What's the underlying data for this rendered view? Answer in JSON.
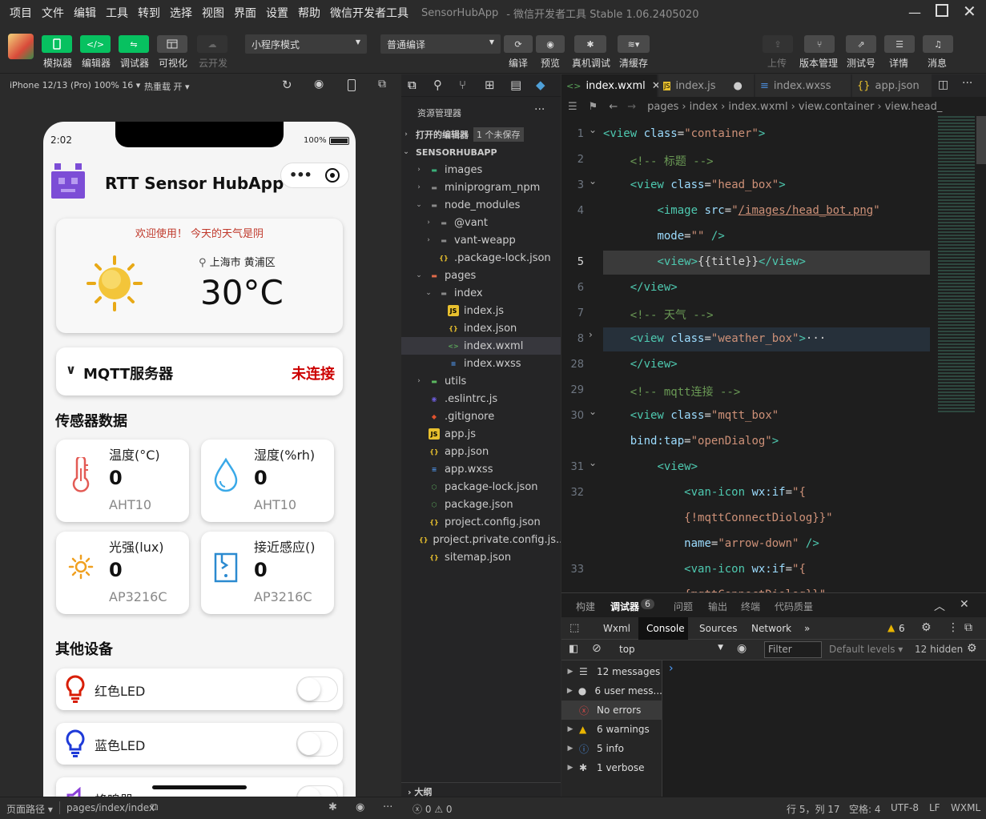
{
  "menubar": {
    "items": [
      "项目",
      "文件",
      "编辑",
      "工具",
      "转到",
      "选择",
      "视图",
      "界面",
      "设置",
      "帮助",
      "微信开发者工具"
    ],
    "app_title": "SensorHubApp",
    "window_title": "- 微信开发者工具 Stable 1.06.2405020"
  },
  "toolbar": {
    "simulator": "模拟器",
    "editor": "编辑器",
    "debugger": "调试器",
    "visual": "可视化",
    "cloud": "云开发",
    "mode_select": "小程序模式",
    "compile_select": "普通编译",
    "compile": "编译",
    "preview": "预览",
    "real_debug": "真机调试",
    "clear_cache": "清缓存",
    "upload": "上传",
    "version": "版本管理",
    "test": "测试号",
    "details": "详情",
    "messages": "消息"
  },
  "simulator_bar": {
    "device": "iPhone 12/13 (Pro) 100% 16",
    "hot_reload": "热重载 开"
  },
  "phone": {
    "time": "2:02",
    "battery": "100%",
    "app_title": "RTT Sensor HubApp",
    "weather": {
      "greeting": "欢迎使用！ 今天的天气是阴",
      "location": "上海市 黄浦区",
      "temperature": "30°C"
    },
    "mqtt": {
      "label": "MQTT服务器",
      "status": "未连接"
    },
    "sensors_title": "传感器数据",
    "sensors": [
      {
        "name": "温度(°C)",
        "value": "0",
        "chip": "AHT10",
        "icon": "thermometer-icon"
      },
      {
        "name": "湿度(%rh)",
        "value": "0",
        "chip": "AHT10",
        "icon": "water-drop-icon"
      },
      {
        "name": "光强(lux)",
        "value": "0",
        "chip": "AP3216C",
        "icon": "sun-icon"
      },
      {
        "name": "接近感应()",
        "value": "0",
        "chip": "AP3216C",
        "icon": "proximity-icon"
      }
    ],
    "devices_title": "其他设备",
    "devices": [
      {
        "label": "红色LED",
        "color": "#d81e06"
      },
      {
        "label": "蓝色LED",
        "color": "#1e3ad8"
      },
      {
        "label": "蜂鸣器",
        "color": "#8a3fd8"
      }
    ]
  },
  "explorer": {
    "title": "资源管理器",
    "open_editors": "打开的编辑器",
    "unsaved": "1 个未保存",
    "project": "SENSORHUBAPP",
    "outline": "大纲",
    "tree": [
      {
        "name": "images",
        "depth": 1,
        "kind": "folder-img",
        "open": false
      },
      {
        "name": "miniprogram_npm",
        "depth": 1,
        "kind": "folder",
        "open": false
      },
      {
        "name": "node_modules",
        "depth": 1,
        "kind": "folder",
        "open": true
      },
      {
        "name": "@vant",
        "depth": 2,
        "kind": "folder",
        "open": false
      },
      {
        "name": "vant-weapp",
        "depth": 2,
        "kind": "folder",
        "open": false
      },
      {
        "name": ".package-lock.json",
        "depth": 2,
        "kind": "json"
      },
      {
        "name": "pages",
        "depth": 1,
        "kind": "folder-pages",
        "open": true
      },
      {
        "name": "index",
        "depth": 2,
        "kind": "folder",
        "open": true
      },
      {
        "name": "index.js",
        "depth": 3,
        "kind": "js"
      },
      {
        "name": "index.json",
        "depth": 3,
        "kind": "json"
      },
      {
        "name": "index.wxml",
        "depth": 3,
        "kind": "wxml",
        "selected": true
      },
      {
        "name": "index.wxss",
        "depth": 3,
        "kind": "wxss"
      },
      {
        "name": "utils",
        "depth": 1,
        "kind": "folder-utils",
        "open": false
      },
      {
        "name": ".eslintrc.js",
        "depth": 1,
        "kind": "eslint"
      },
      {
        "name": ".gitignore",
        "depth": 1,
        "kind": "git"
      },
      {
        "name": "app.js",
        "depth": 1,
        "kind": "js"
      },
      {
        "name": "app.json",
        "depth": 1,
        "kind": "json"
      },
      {
        "name": "app.wxss",
        "depth": 1,
        "kind": "wxss"
      },
      {
        "name": "package-lock.json",
        "depth": 1,
        "kind": "npm"
      },
      {
        "name": "package.json",
        "depth": 1,
        "kind": "npm"
      },
      {
        "name": "project.config.json",
        "depth": 1,
        "kind": "json"
      },
      {
        "name": "project.private.config.js...",
        "depth": 1,
        "kind": "json"
      },
      {
        "name": "sitemap.json",
        "depth": 1,
        "kind": "json"
      }
    ]
  },
  "editor": {
    "tabs": [
      "index.wxml",
      "index.js",
      "index.wxss",
      "app.json"
    ],
    "breadcrumb": [
      "pages",
      "index",
      "index.wxml",
      "view.container",
      "view.head_"
    ],
    "lines": [
      {
        "n": "1",
        "fold": "v",
        "html": "<span class=\"tg\">&lt;view</span> <span class=\"at\">class</span>=<span class=\"st\">\"container\"</span><span class=\"tg\">&gt;</span>"
      },
      {
        "n": "2",
        "fold": "",
        "html": "    <span class=\"cm\">&lt;!-- 标题 --&gt;</span>"
      },
      {
        "n": "3",
        "fold": "v",
        "html": "    <span class=\"tg\">&lt;view</span> <span class=\"at\">class</span>=<span class=\"st\">\"head_box\"</span><span class=\"tg\">&gt;</span>"
      },
      {
        "n": "4",
        "fold": "",
        "html": "        <span class=\"tg\">&lt;image</span> <span class=\"at\">src</span>=<span class=\"st\">\"<u>/images/head_bot.png</u>\"</span>"
      },
      {
        "n": "",
        "fold": "",
        "html": "        <span class=\"at\">mode</span>=<span class=\"st\">\"\"</span> <span class=\"tg\">/&gt;</span>"
      },
      {
        "n": "5",
        "fold": "",
        "html": "        <span class=\"tg\">&lt;view&gt;</span>{{<span class=\"pl\">title</span>}}<span class=\"tg\">&lt;/view&gt;</span>",
        "hl": true
      },
      {
        "n": "6",
        "fold": "",
        "html": "    <span class=\"tg\">&lt;/view&gt;</span>"
      },
      {
        "n": "7",
        "fold": "",
        "html": "    <span class=\"cm\">&lt;!-- 天气 --&gt;</span>"
      },
      {
        "n": "8",
        "fold": "&gt;",
        "html": "    <span class=\"tg\">&lt;view</span> <span class=\"at\">class</span>=<span class=\"st\">\"weather_box\"</span><span class=\"tg\">&gt;</span>···",
        "hl2": true
      },
      {
        "n": "28",
        "fold": "",
        "html": "    <span class=\"tg\">&lt;/view&gt;</span>"
      },
      {
        "n": "29",
        "fold": "",
        "html": "    <span class=\"cm\">&lt;!-- mqtt连接 --&gt;</span>"
      },
      {
        "n": "30",
        "fold": "v",
        "html": "    <span class=\"tg\">&lt;view</span> <span class=\"at\">class</span>=<span class=\"st\">\"mqtt_box\"</span>"
      },
      {
        "n": "",
        "fold": "",
        "html": "    <span class=\"at\">bind:tap</span>=<span class=\"st\">\"openDialog\"</span><span class=\"tg\">&gt;</span>"
      },
      {
        "n": "31",
        "fold": "v",
        "html": "        <span class=\"tg\">&lt;view&gt;</span>"
      },
      {
        "n": "32",
        "fold": "",
        "html": "            <span class=\"tg\">&lt;van-icon</span> <span class=\"at\">wx:if</span>=<span class=\"st\">\"{</span>"
      },
      {
        "n": "",
        "fold": "",
        "html": "            <span class=\"st\">{!mqttConnectDiolog}}\"</span>"
      },
      {
        "n": "",
        "fold": "",
        "html": "            <span class=\"at\">name</span>=<span class=\"st\">\"arrow-down\"</span> <span class=\"tg\">/&gt;</span>"
      },
      {
        "n": "33",
        "fold": "",
        "html": "            <span class=\"tg\">&lt;van-icon</span> <span class=\"at\">wx:if</span>=<span class=\"st\">\"{</span>"
      },
      {
        "n": "",
        "fold": "",
        "html": "            <span class=\"st\">{mqttConnectDiolog}}\"</span>"
      }
    ]
  },
  "panel": {
    "tabs": [
      "构建",
      "调试器",
      "问题",
      "输出",
      "终端",
      "代码质量"
    ],
    "debugger_count": "6",
    "devtools_tabs": [
      "Wxml",
      "Console",
      "Sources",
      "Network"
    ],
    "warn_count": "6",
    "context": "top",
    "filter_placeholder": "Filter",
    "levels": "Default levels",
    "hidden": "12 hidden",
    "messages": [
      {
        "label": "12 messages",
        "icon": "list-icon"
      },
      {
        "label": "6 user mess...",
        "icon": "user-icon"
      },
      {
        "label": "No errors",
        "icon": "error-icon"
      },
      {
        "label": "6 warnings",
        "icon": "warning-icon"
      },
      {
        "label": "5 info",
        "icon": "info-icon"
      },
      {
        "label": "1 verbose",
        "icon": "bug-icon"
      }
    ]
  },
  "statusbar": {
    "page_path_label": "页面路径",
    "page_path": "pages/index/index",
    "errors": "0",
    "warnings": "0",
    "cursor": "行 5，列 17",
    "spaces": "空格: 4",
    "encoding": "UTF-8",
    "eol": "LF",
    "language": "WXML"
  }
}
